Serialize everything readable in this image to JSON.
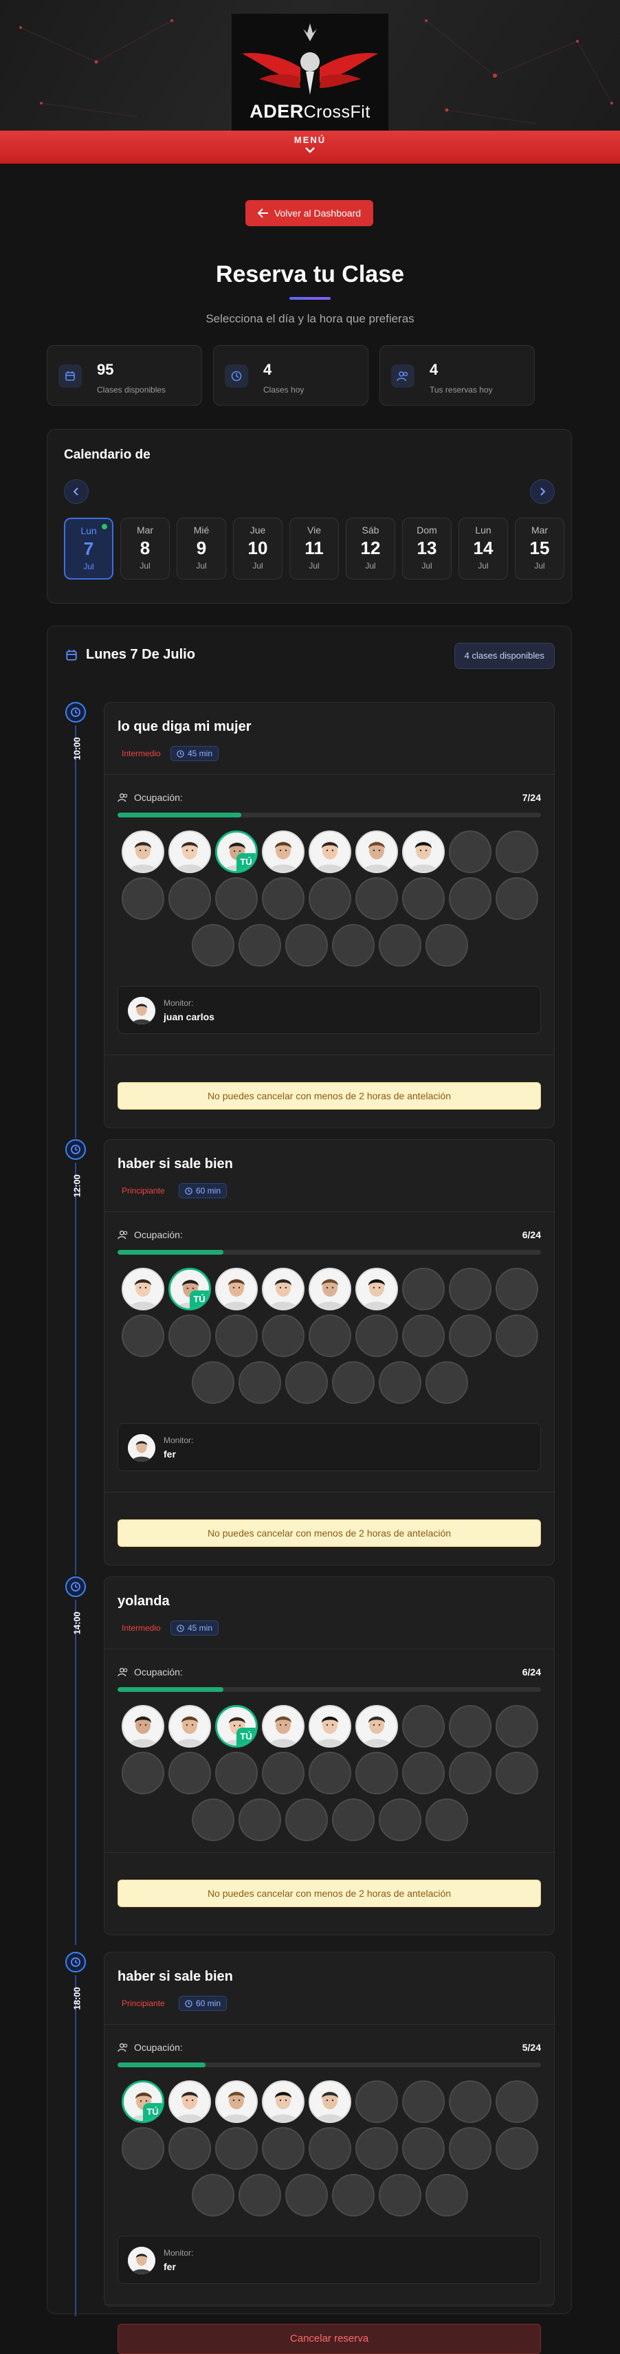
{
  "header": {
    "logo_text": "ADER",
    "logo_text_2": "CrossFit",
    "menu_label": "MENÚ"
  },
  "back_button": "Volver al Dashboard",
  "page": {
    "title": "Reserva tu Clase",
    "subtitle": "Selecciona el día y la hora que prefieras"
  },
  "stats": [
    {
      "value": "95",
      "label": "Clases disponibles",
      "icon": "calendar-icon"
    },
    {
      "value": "4",
      "label": "Clases hoy",
      "icon": "clock-icon"
    },
    {
      "value": "4",
      "label": "Tus reservas hoy",
      "icon": "users-icon"
    }
  ],
  "calendar": {
    "title": "Calendario de",
    "days": [
      {
        "name": "Lun",
        "date": "7",
        "month": "Jul",
        "selected": true
      },
      {
        "name": "Mar",
        "date": "8",
        "month": "Jul"
      },
      {
        "name": "Mié",
        "date": "9",
        "month": "Jul"
      },
      {
        "name": "Jue",
        "date": "10",
        "month": "Jul"
      },
      {
        "name": "Vie",
        "date": "11",
        "month": "Jul"
      },
      {
        "name": "Sáb",
        "date": "12",
        "month": "Jul"
      },
      {
        "name": "Dom",
        "date": "13",
        "month": "Jul"
      },
      {
        "name": "Lun",
        "date": "14",
        "month": "Jul"
      },
      {
        "name": "Mar",
        "date": "15",
        "month": "Jul"
      }
    ]
  },
  "schedule": {
    "heading": "Lunes 7 De Julio",
    "available": "4 clases disponibles",
    "occupancy_label": "Ocupación:",
    "monitor_label": "Monitor:",
    "me_badge": "TÚ",
    "classes": [
      {
        "time": "10:00",
        "name": "lo que diga mi mujer",
        "level": "Intermedio",
        "duration": "45 min",
        "occupancy": "7/24",
        "booked": 7,
        "capacity": 24,
        "me_index": 2,
        "monitor": "juan carlos",
        "action": "No puedes cancelar con menos de 2 horas de antelación",
        "action_type": "warning"
      },
      {
        "time": "12:00",
        "name": "haber si sale bien",
        "level": "Principiante",
        "duration": "60 min",
        "occupancy": "6/24",
        "booked": 6,
        "capacity": 24,
        "me_index": 1,
        "monitor": "fer",
        "action": "No puedes cancelar con menos de 2 horas de antelación",
        "action_type": "warning"
      },
      {
        "time": "14:00",
        "name": "yolanda",
        "level": "Intermedio",
        "duration": "45 min",
        "occupancy": "6/24",
        "booked": 6,
        "capacity": 24,
        "me_index": 2,
        "monitor": null,
        "action": "No puedes cancelar con menos de 2 horas de antelación",
        "action_type": "warning"
      },
      {
        "time": "18:00",
        "name": "haber si sale bien",
        "level": "Principiante",
        "duration": "60 min",
        "occupancy": "5/24",
        "booked": 5,
        "capacity": 24,
        "me_index": 0,
        "monitor": "fer",
        "action": "Cancelar reserva",
        "action_type": "cancel"
      }
    ]
  },
  "colors": {
    "accent_red": "#d93030",
    "accent_blue": "#3b82f6",
    "success_green": "#10b981"
  }
}
